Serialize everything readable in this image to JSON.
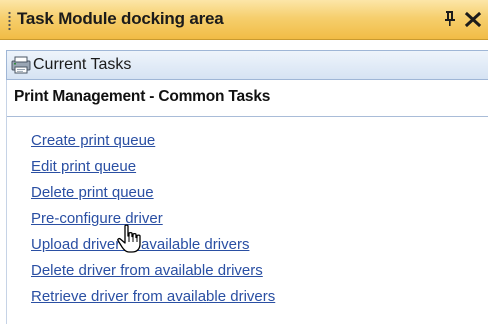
{
  "titlebar": {
    "title": "Task Module docking area",
    "pin_icon": "pin-icon",
    "close_icon": "close-icon"
  },
  "panel": {
    "title": "Current Tasks",
    "icon": "printer-icon"
  },
  "section": {
    "title": "Print Management - Common Tasks"
  },
  "tasks": [
    {
      "label": "Create print queue"
    },
    {
      "label": "Edit print queue"
    },
    {
      "label": "Delete print queue"
    },
    {
      "label": "Pre-configure driver"
    },
    {
      "label": "Upload driver to available drivers"
    },
    {
      "label": "Delete driver from available drivers"
    },
    {
      "label": "Retrieve driver from available drivers"
    }
  ],
  "colors": {
    "titlebar": "#f6cf6e",
    "panel_header": "#d6e3f3",
    "link": "#2a4fa3"
  }
}
